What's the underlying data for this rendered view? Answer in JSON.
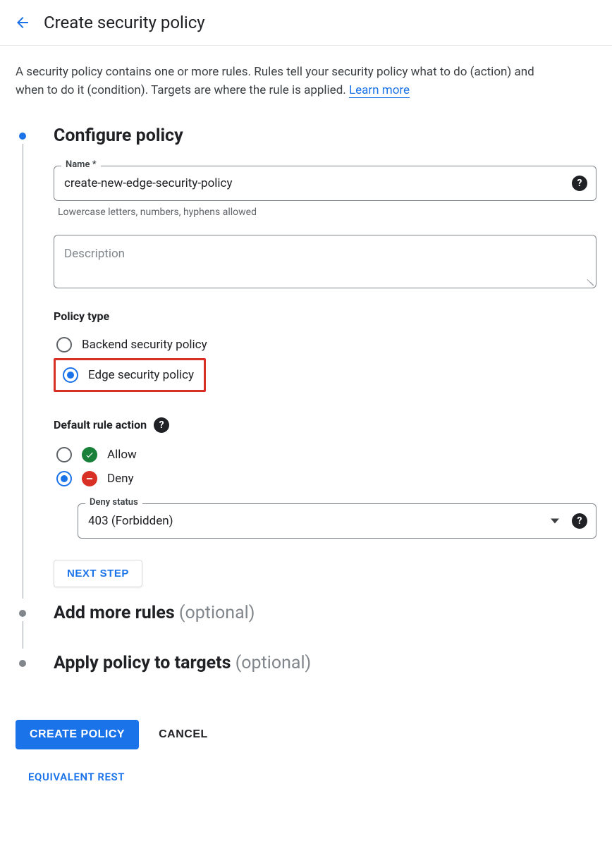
{
  "header": {
    "title": "Create security policy"
  },
  "intro": {
    "text": "A security policy contains one or more rules. Rules tell your security policy what to do (action) and when to do it (condition). Targets are where the rule is applied. ",
    "learn_more": "Learn more"
  },
  "steps": {
    "configure": {
      "heading": "Configure policy",
      "name_label": "Name *",
      "name_value": "create-new-edge-security-policy",
      "name_helper": "Lowercase letters, numbers, hyphens allowed",
      "description_placeholder": "Description",
      "policy_type_label": "Policy type",
      "policy_type_options": {
        "backend": "Backend security policy",
        "edge": "Edge security policy"
      },
      "default_rule_label": "Default rule action",
      "actions": {
        "allow": "Allow",
        "deny": "Deny"
      },
      "deny_status_label": "Deny status",
      "deny_status_value": "403 (Forbidden)",
      "next_step_label": "NEXT STEP"
    },
    "add_rules": {
      "heading": "Add more rules",
      "optional": "(optional)"
    },
    "apply_targets": {
      "heading": "Apply policy to targets",
      "optional": "(optional)"
    }
  },
  "footer": {
    "create": "CREATE POLICY",
    "cancel": "CANCEL",
    "equivalent_rest": "EQUIVALENT REST"
  }
}
